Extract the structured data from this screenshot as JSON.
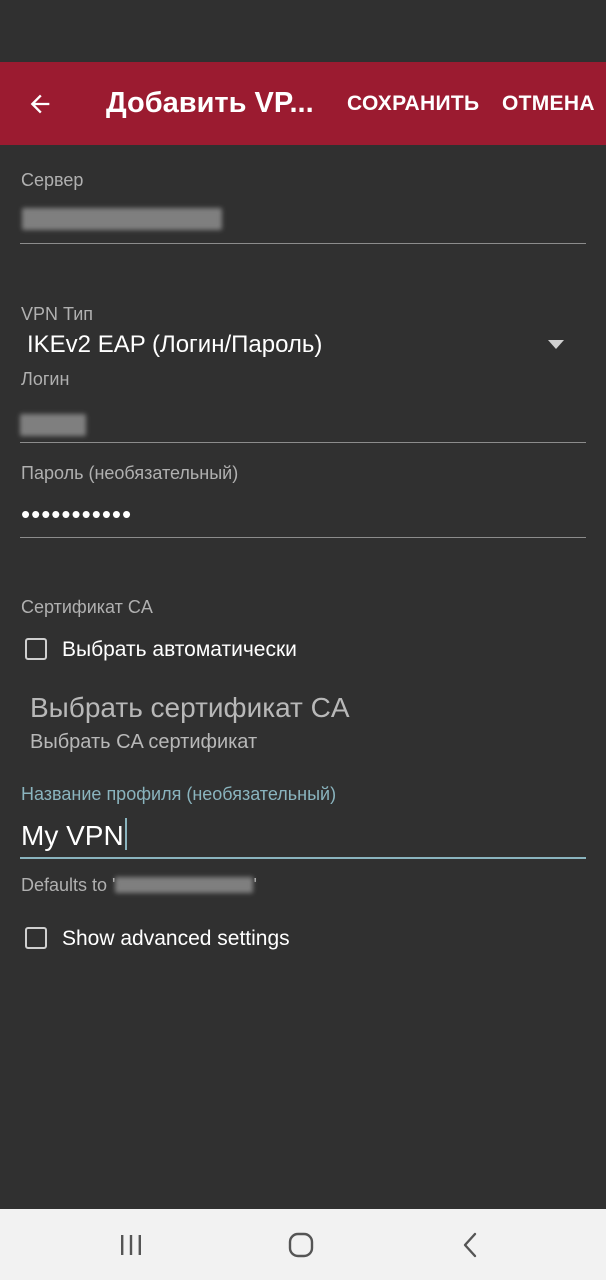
{
  "appbar": {
    "title": "Добавить VP...",
    "save_label": "СОХРАНИТЬ",
    "cancel_label": "ОТМЕНА",
    "background": "#9b1b30"
  },
  "form": {
    "server": {
      "label": "Сервер"
    },
    "vpn_type": {
      "label": "VPN Тип",
      "value": "IKEv2 EAP (Логин/Пароль)"
    },
    "login": {
      "label": "Логин"
    },
    "password": {
      "label": "Пароль (необязательный)",
      "value": "•••••••••••"
    },
    "ca_certificate": {
      "label": "Сертификат CA",
      "auto_select_label": "Выбрать автоматически",
      "auto_select_checked": false,
      "pick_title": "Выбрать сертификат CA",
      "pick_summary": "Выбрать CA сертификат"
    },
    "profile_name": {
      "label": "Название профиля (необязательный)",
      "value": "My VPN"
    },
    "defaults_prefix": "Defaults to '",
    "defaults_suffix": "'",
    "advanced": {
      "label": "Show advanced settings",
      "checked": false
    }
  },
  "colors": {
    "background": "#303030",
    "accent_focus": "#8ab4be",
    "navbar": "#f2f2f2"
  }
}
